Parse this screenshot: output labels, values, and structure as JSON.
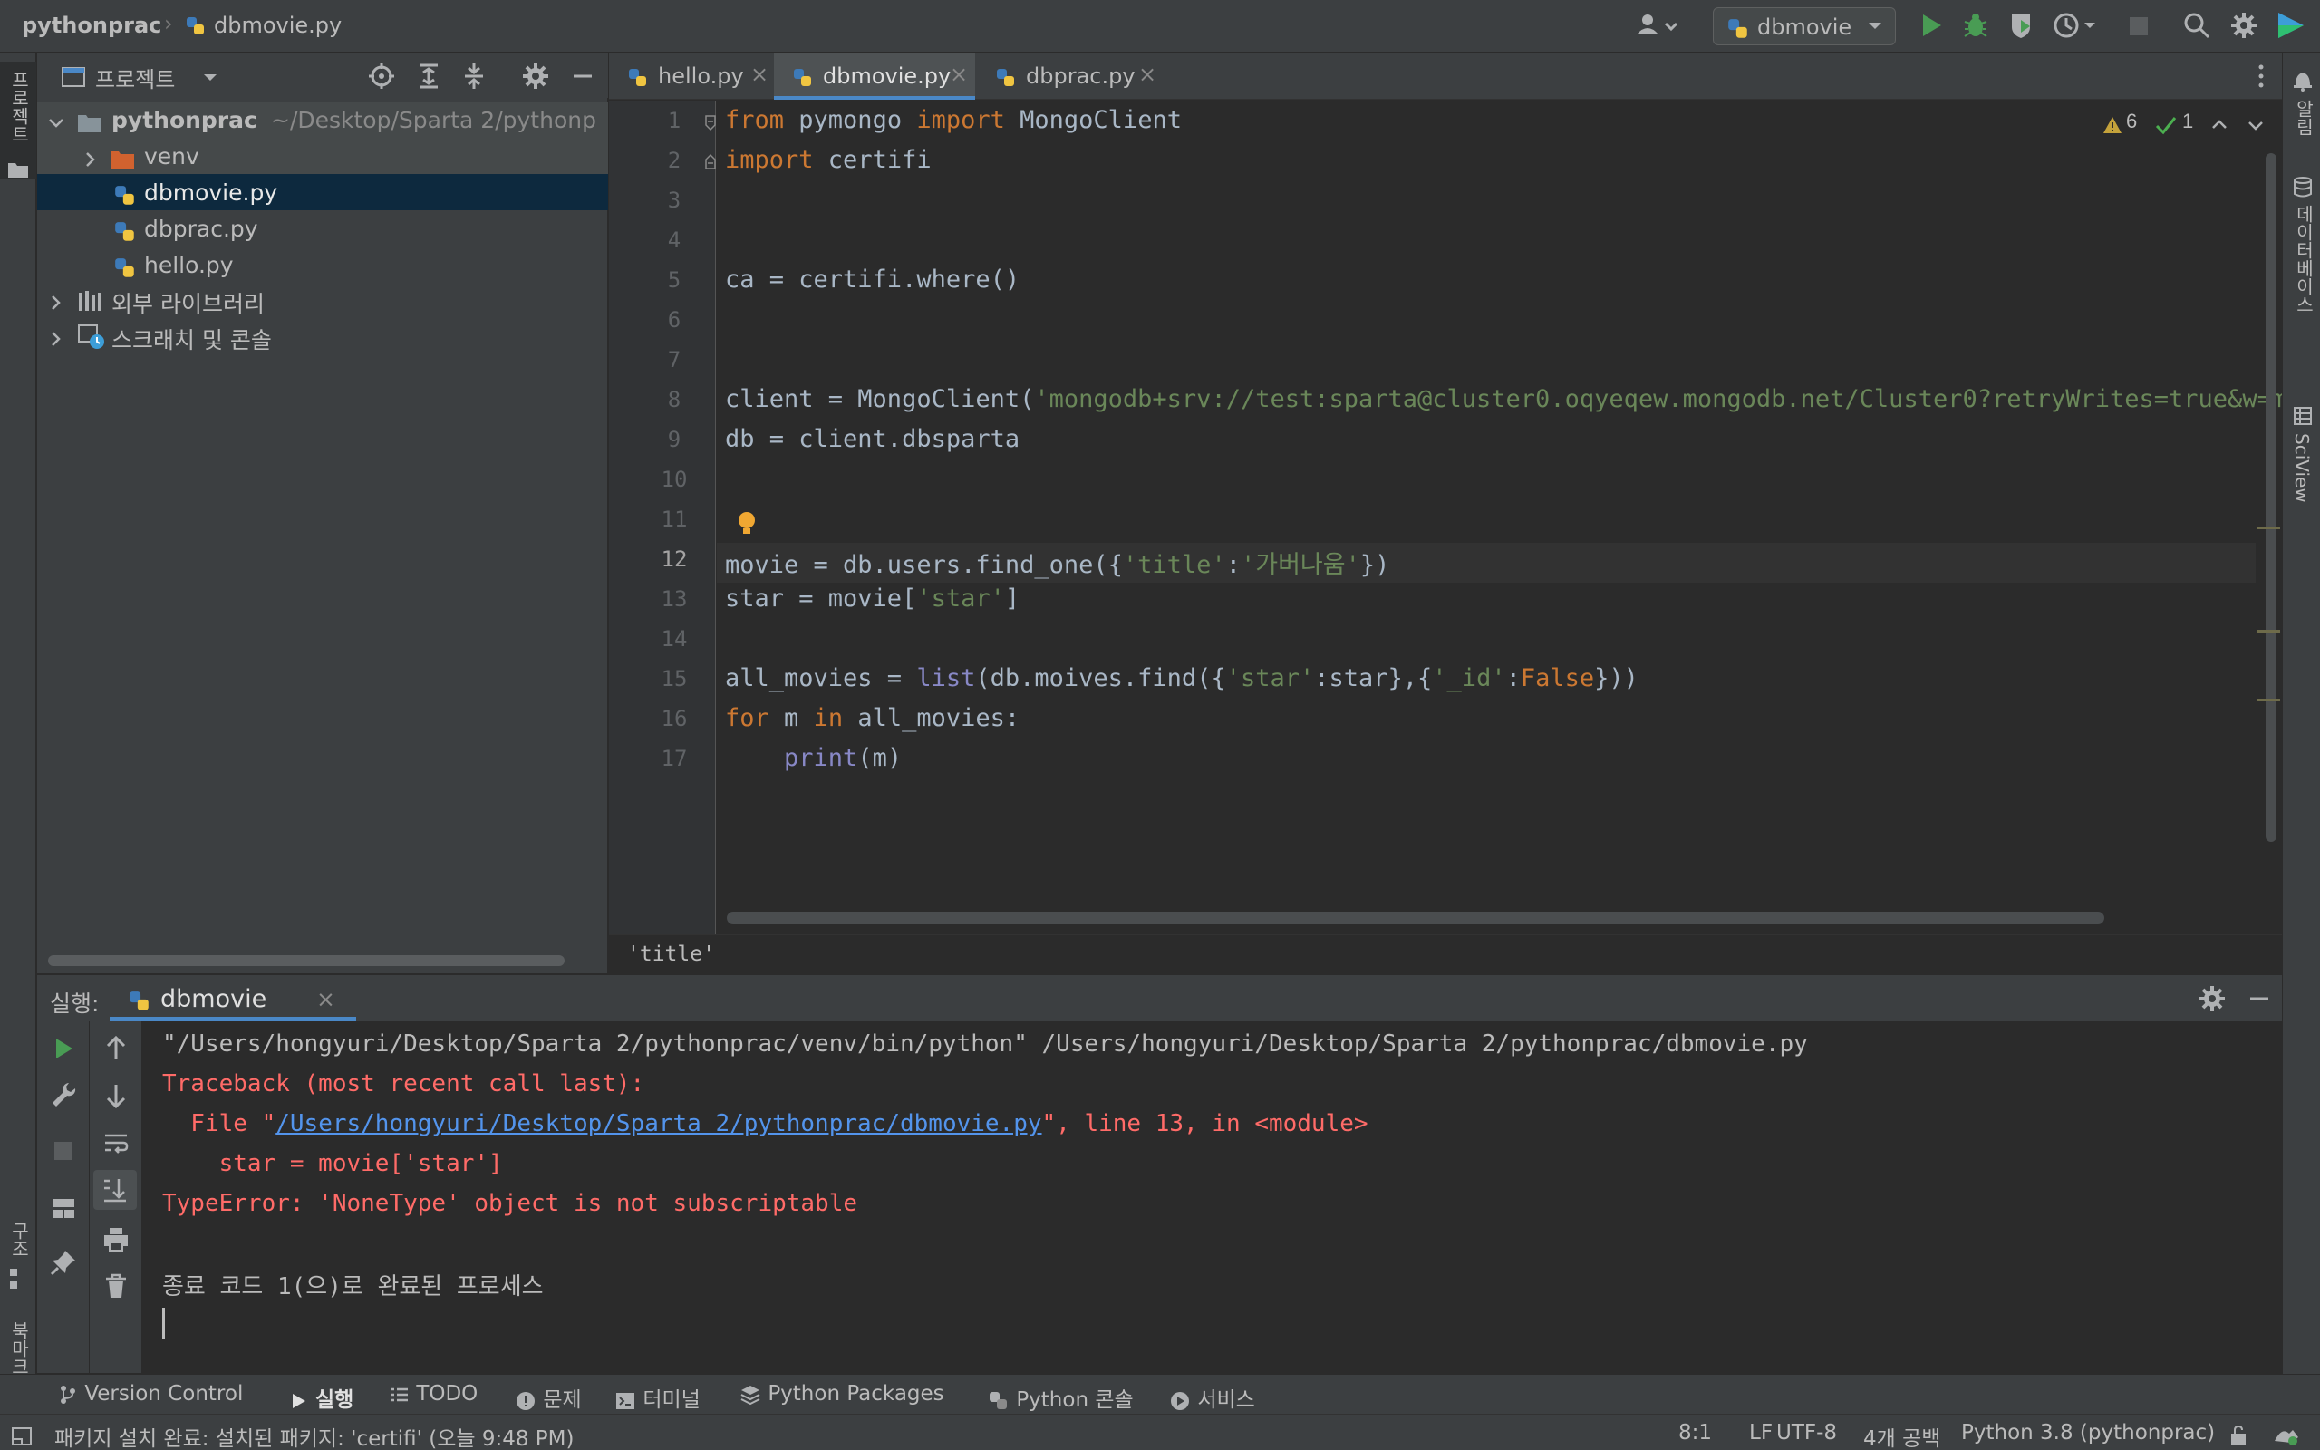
{
  "topbar": {
    "project_name": "pythonprac",
    "file_name": "dbmovie.py",
    "run_config": "dbmovie"
  },
  "left_stripe": {
    "project_label": "프로젝트",
    "structure_label": "구조",
    "bookmarks_label": "북마크"
  },
  "right_stripe": {
    "notifications_label": "알림",
    "database_label": "데이터베이스",
    "sciview_label": "SciView"
  },
  "project_panel": {
    "title": "프로젝트",
    "tree": [
      {
        "label": "pythonprac",
        "suffix": "~/Desktop/Sparta 2/pythonp",
        "kind": "root-folder"
      },
      {
        "label": "venv",
        "kind": "folder"
      },
      {
        "label": "dbmovie.py",
        "kind": "python-file",
        "selected": true
      },
      {
        "label": "dbprac.py",
        "kind": "python-file"
      },
      {
        "label": "hello.py",
        "kind": "python-file"
      },
      {
        "label": "외부 라이브러리",
        "kind": "library"
      },
      {
        "label": "스크래치 및 콘솔",
        "kind": "scratch"
      }
    ]
  },
  "editor": {
    "tabs": [
      {
        "label": "hello.py"
      },
      {
        "label": "dbmovie.py",
        "active": true
      },
      {
        "label": "dbprac.py"
      }
    ],
    "inspection": {
      "warnings": "6",
      "ok": "1"
    },
    "line_numbers": [
      "1",
      "2",
      "3",
      "4",
      "5",
      "6",
      "7",
      "8",
      "9",
      "10",
      "11",
      "12",
      "13",
      "14",
      "15",
      "16",
      "17"
    ],
    "current_line": "12",
    "breadcrumb": "'title'"
  },
  "run_panel": {
    "label": "실행:",
    "tab": "dbmovie",
    "output": {
      "cmd": "\"/Users/hongyuri/Desktop/Sparta 2/pythonprac/venv/bin/python\" /Users/hongyuri/Desktop/Sparta 2/pythonprac/dbmovie.py",
      "traceback": "Traceback (most recent call last):",
      "file_prefix": "  File \"",
      "file_link": "/Users/hongyuri/Desktop/Sparta 2/pythonprac/dbmovie.py",
      "file_suffix": "\", line 13, in <module>",
      "src_line": "    star = movie['star']",
      "error": "TypeError: 'NoneType' object is not subscriptable",
      "exit": "종료 코드 1(으)로 완료된 프로세스"
    }
  },
  "bottom_tabs": {
    "vcs": "Version Control",
    "run": "실행",
    "todo": "TODO",
    "problems": "문제",
    "terminal": "터미널",
    "packages": "Python Packages",
    "console": "Python 콘솔",
    "services": "서비스"
  },
  "statusbar": {
    "message": "패키지 설치 완료: 설치된 패키지: 'certifi' (오늘 9:48 PM)",
    "position": "8:1",
    "line_sep": "LF",
    "encoding": "UTF-8",
    "indent": "4개 공백",
    "interpreter": "Python 3.8 (pythonprac)"
  }
}
